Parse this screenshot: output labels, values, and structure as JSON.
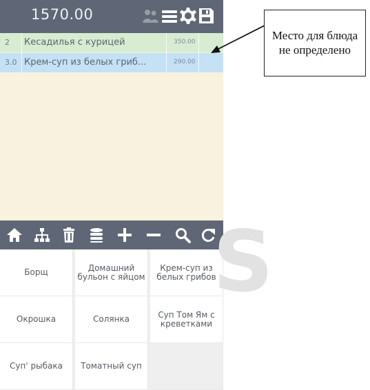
{
  "header": {
    "total": "1570.00",
    "icons": {
      "people": "people-icon",
      "menu": "menu-icon",
      "settings": "settings-icon",
      "save": "save-icon"
    },
    "colors": {
      "bar": "#5f6675",
      "icon": "#ffffff",
      "people_icon": "#969ca6"
    }
  },
  "order": {
    "items": [
      {
        "qty": "2",
        "name": "Кесадилья с курицей",
        "price": "350.00",
        "color": "#d7ecd1"
      },
      {
        "qty": "3.0",
        "name": "Крем-суп из белых гриб...",
        "price": "290.00",
        "color": "#c4e1f5"
      }
    ],
    "background": "#f8f2df"
  },
  "toolbar": {
    "icons": [
      "home-icon",
      "hierarchy-icon",
      "trash-icon",
      "stack-icon",
      "plus-icon",
      "minus-icon",
      "search-icon",
      "refresh-icon"
    ]
  },
  "menu": {
    "items": [
      "Борщ",
      "Домашний бульон с яйцом",
      "Крем-суп из белых грибов",
      "Окрошка",
      "Солянка",
      "Суп Том Ям с креветками",
      "Суп' рыбака",
      "Томатный суп",
      ""
    ]
  },
  "callout": {
    "text": "Место для блюда не определено"
  },
  "watermark": {
    "text": "S",
    "color": "#e2e2e2"
  }
}
